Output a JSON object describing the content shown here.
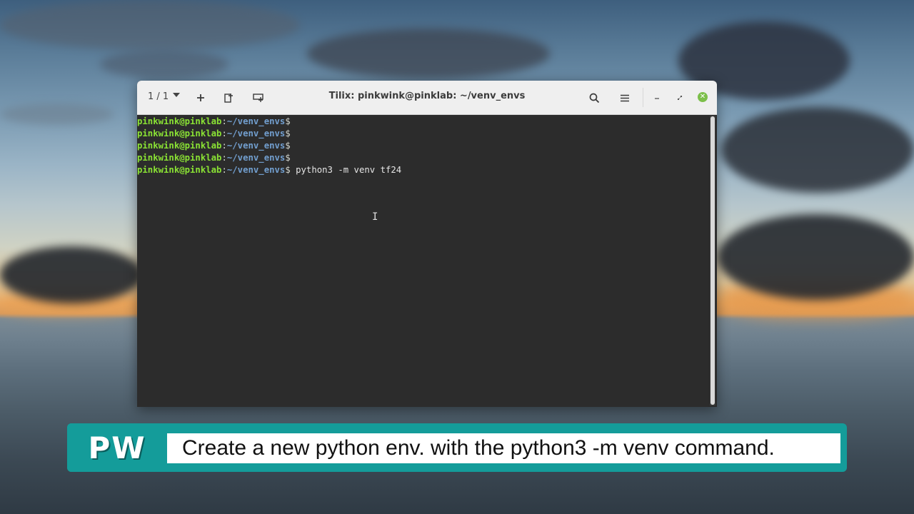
{
  "window": {
    "title": "Tilix: pinkwink@pinklab: ~/venv_envs",
    "session_label": "1 / 1"
  },
  "terminal": {
    "lines": [
      {
        "user": "pinkwink@pinklab",
        "colon": ":",
        "path": "~/venv_envs",
        "dollar": "$",
        "command": ""
      },
      {
        "user": "pinkwink@pinklab",
        "colon": ":",
        "path": "~/venv_envs",
        "dollar": "$",
        "command": ""
      },
      {
        "user": "pinkwink@pinklab",
        "colon": ":",
        "path": "~/venv_envs",
        "dollar": "$",
        "command": ""
      },
      {
        "user": "pinkwink@pinklab",
        "colon": ":",
        "path": "~/venv_envs",
        "dollar": "$",
        "command": ""
      },
      {
        "user": "pinkwink@pinklab",
        "colon": ":",
        "path": "~/venv_envs",
        "dollar": "$",
        "command": " python3 -m venv tf24"
      }
    ]
  },
  "caption": {
    "logo": "PW",
    "text": "Create a new python env. with the python3 -m venv command."
  },
  "colors": {
    "prompt_user": "#8ae234",
    "prompt_path": "#729fcf",
    "caption_teal": "#149c9a",
    "close_button": "#7cbf4a"
  },
  "icons": [
    "chevron-down-icon",
    "plus-icon",
    "split-right-icon",
    "split-down-icon",
    "search-icon",
    "hamburger-menu-icon",
    "minimize-icon",
    "restore-icon",
    "close-icon",
    "text-cursor-icon"
  ]
}
